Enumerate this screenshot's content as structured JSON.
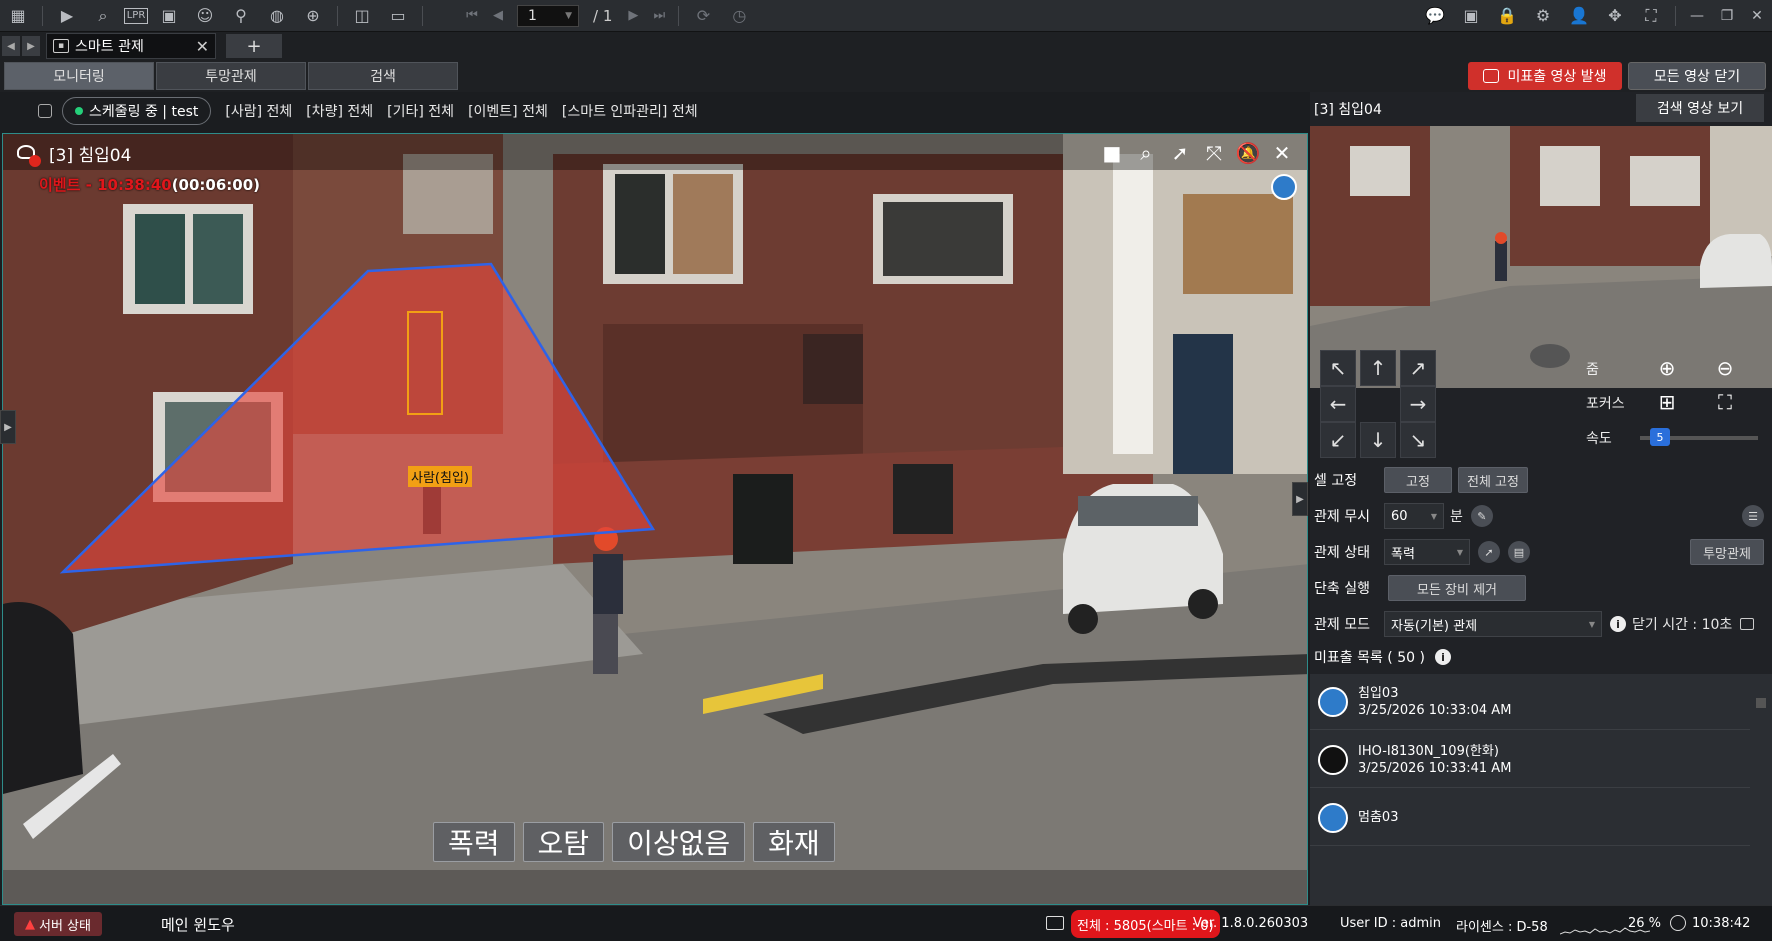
{
  "toolbar": {
    "page_current": "1",
    "page_separator": "/",
    "page_total": "1"
  },
  "tabs": {
    "current_tab": "스마트 관제",
    "add_label": "+"
  },
  "menu": {
    "tabs": [
      "모니터링",
      "투망관제",
      "검색"
    ],
    "alert_button": "미표출 영상 발생",
    "close_all_button": "모든 영상 닫기"
  },
  "filter": {
    "schedule": "스케줄링 중 | test",
    "items": [
      "[사람] 전체",
      "[차량] 전체",
      "[기타] 전체",
      "[이벤트] 전체",
      "[스마트 인파관리] 전체"
    ]
  },
  "video": {
    "title": "[3] 침입04",
    "event_label": "이벤트",
    "event_sep": " - ",
    "event_time": "10:38:40",
    "event_duration": "(00:06:00)",
    "detection_label": "사람(침입)",
    "event_buttons": [
      "폭력",
      "오탐",
      "이상없음",
      "화재"
    ]
  },
  "right_panel": {
    "title": "[3] 침입04",
    "search_video_button": "검색 영상 보기",
    "zoom_label": "줌",
    "focus_label": "포커스",
    "speed_label": "속도",
    "speed_value": "5",
    "cell_fix_label": "셀 고정",
    "fix_button": "고정",
    "fix_all_button": "전체 고정",
    "ignore_label": "관제 무시",
    "ignore_value": "60",
    "ignore_unit": "분",
    "status_label": "관제 상태",
    "status_value": "폭력",
    "net_button": "투망관제",
    "shortcut_label": "단축 실행",
    "remove_all_button": "모든 장비 제거",
    "mode_label": "관제 모드",
    "mode_value": "자동(기본) 관제",
    "close_time": "닫기 시간 : 10초",
    "list_title": "미표출 목록 ( 50 )",
    "list_items": [
      {
        "name": "침입03",
        "time": "3/25/2026 10:33:04 AM",
        "color": "#2e7bc9"
      },
      {
        "name": "IHO-I8130N_109(한화)",
        "time": "3/25/2026 10:33:41 AM",
        "color": "#111111"
      },
      {
        "name": "멈춤03",
        "time": "",
        "color": "#2e7bc9"
      }
    ]
  },
  "status_bar": {
    "server_status": "서버 상태",
    "main_window": "메인 윈도우",
    "total": "전체 : 5805(스마트 : 0)",
    "version": "Ver. 1.8.0.260303",
    "user": "User ID : admin",
    "license": "라이센스 : D-58",
    "cpu": "26 %",
    "clock": "10:38:42"
  }
}
